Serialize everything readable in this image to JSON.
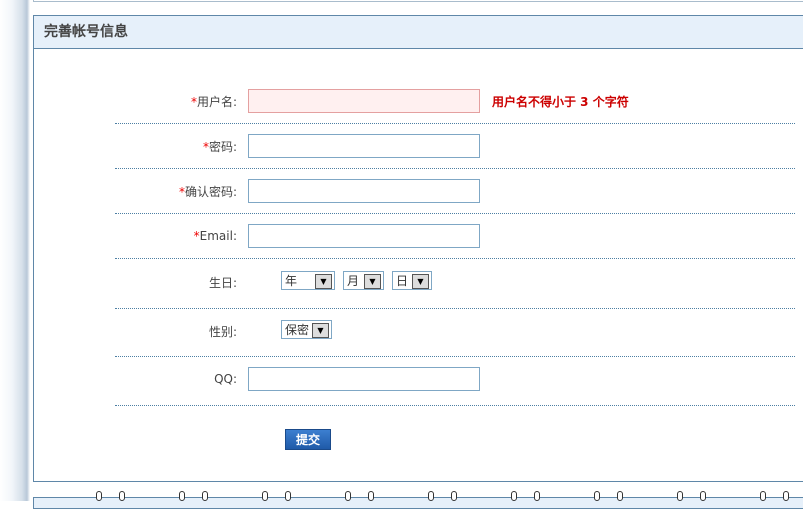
{
  "panel": {
    "title": "完善帐号信息"
  },
  "form": {
    "required_mark": "*",
    "username": {
      "label": "用户名:",
      "value": "",
      "error": "用户名不得小于 3 个字符"
    },
    "password": {
      "label": "密码:",
      "value": ""
    },
    "confirm_password": {
      "label": "确认密码:",
      "value": ""
    },
    "email": {
      "label": "Email:",
      "value": ""
    },
    "birthday": {
      "label": "生日:",
      "year": "年",
      "month": "月",
      "day": "日"
    },
    "gender": {
      "label": "性别:",
      "value": "保密"
    },
    "qq": {
      "label": "QQ:",
      "value": ""
    },
    "submit_label": "提交"
  }
}
